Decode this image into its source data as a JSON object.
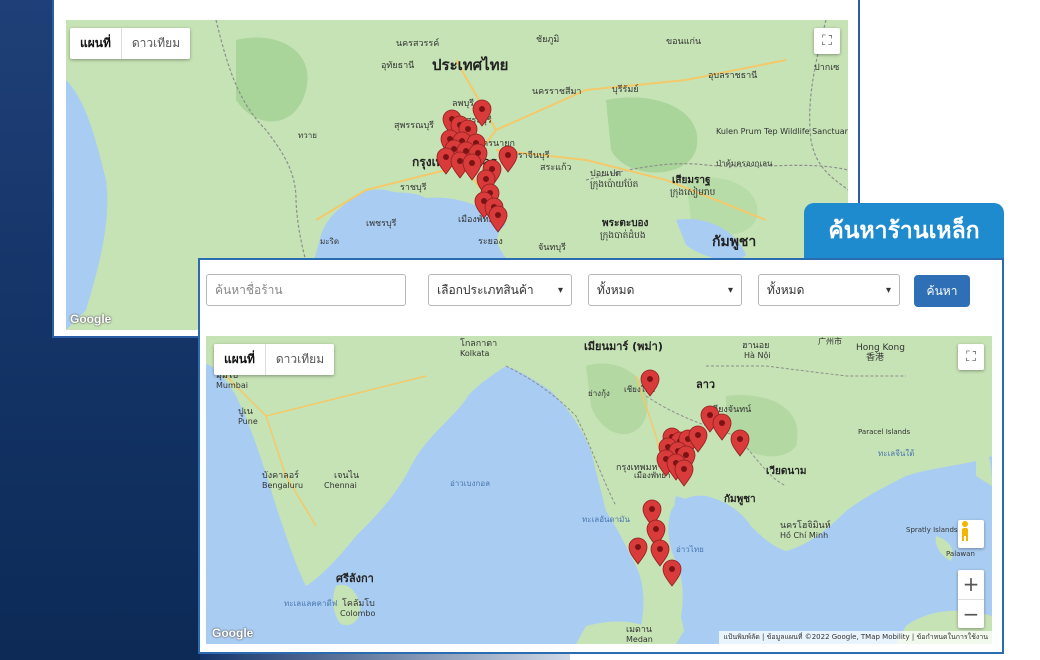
{
  "title": "ค้นหาร้านเหล็ก",
  "map_type": {
    "map": "แผนที่",
    "satellite": "ดาวเทียม"
  },
  "search": {
    "shop_name_placeholder": "ค้นหาชื่อร้าน",
    "category_selected": "เลือกประเภทสินค้า",
    "province_selected": "ทั้งหมด",
    "district_selected": "ทั้งหมด",
    "button_label": "ค้นหา"
  },
  "google_logo": "Google",
  "attribution": "แป้นพิมพ์ลัด | ข้อมูลแผนที่ ©2022 Google, TMap Mobility | ข้อกำหนดในการใช้งาน",
  "colors": {
    "marker": "#d93b3b",
    "sea": "#a9cdf2",
    "land": "#c6e3b5",
    "accent": "#1f8bcf",
    "button": "#2e6fb5"
  },
  "back_map_labels": {
    "thailand": "ประเทศไทย",
    "nakhon_sawan": "นครสวรรค์",
    "uthai_thani": "อุทัยธานี",
    "chaiyaphum": "ชัยภูมิ",
    "khon_kaen": "ขอนแก่น",
    "nakhon_ratchasima": "นครราชสีมา",
    "buriram": "บุรีรัมย์",
    "ubon": "อุบลราชธานี",
    "pakse": "ปากเซ",
    "lopburi": "ลพบุรี",
    "saraburi": "สระบุรี",
    "suphan": "สุพรรณบุรี",
    "nakhon_nayok": "นครนายก",
    "prachinburi": "ปราจีนบุรี",
    "sa_kaeo": "สระแก้ว",
    "bangkok": "กรุงเทพมหานคร",
    "ratchaburi": "ราชบุรี",
    "phetchaburi": "เพชรบุรี",
    "pattaya": "เมืองพัทยา",
    "rayong": "ระยอง",
    "chanthaburi": "จันทบุรี",
    "poipet": "ปอยเปต",
    "poipet_kh": "ក្រុងប៉ោយប៉ែត",
    "siem_reap": "เสียมราฐ",
    "siem_reap_kh": "ក្រុងសៀមរាប",
    "pursat": "พระตะบอง",
    "pursat_kh": "ក្រុងបាត់ដំបង",
    "cambodia": "กัมพูชา",
    "kulen": "Kulen Prum Tep Wildlife Sanctuary",
    "kulen_th": "ป่าคุ้มครองกุเลน",
    "tavoy": "ทวาย",
    "mergui": "มะริด"
  },
  "front_map_labels": {
    "myanmar": "เมียนมาร์ (พม่า)",
    "laos": "ลาว",
    "hanoi": "ฮานอย",
    "hanoi_vn": "Hà Nội",
    "hong_kong": "Hong Kong",
    "hong_kong_zh": "香港",
    "guangzhou": "广州市",
    "kolkata": "โกลกาตา",
    "kolkata_en": "Kolkata",
    "mumbai": "มุมไบ",
    "mumbai_en": "Mumbai",
    "pune": "ปูเน",
    "pune_en": "Pune",
    "bengaluru": "บังคาลอร์",
    "bengaluru_en": "Bengaluru",
    "chennai": "เจนไน",
    "chennai_en": "Chennai",
    "sri_lanka": "ศรีลังกา",
    "colombo": "โคลัมโบ",
    "colombo_en": "Colombo",
    "vientiane": "เวียงจันทน์",
    "vietnam": "เวียดนาม",
    "cambodia": "กัมพูชา",
    "bangkok": "กรุงเทพมหานคร",
    "pattaya": "เมืองพัทยา",
    "hcmc": "นครโฮจิมินห์",
    "hcmc_vn": "Hồ Chí Minh",
    "bay_of_bengal": "อ่าวเบงกอล",
    "andaman": "ทะเลอันดามัน",
    "gulf_thailand": "อ่าวไทย",
    "paracel": "Paracel Islands",
    "spratly": "Spratly Islands",
    "palawan": "Palawan",
    "medan": "เมดาน",
    "medan_en": "Medan",
    "laccadive": "ทะเลแลคคาดีฟ",
    "south_china_sea": "ทะเลจีนใต้",
    "chiang_mai": "เชียงใหม่",
    "yangon": "ย่างกุ้ง"
  }
}
